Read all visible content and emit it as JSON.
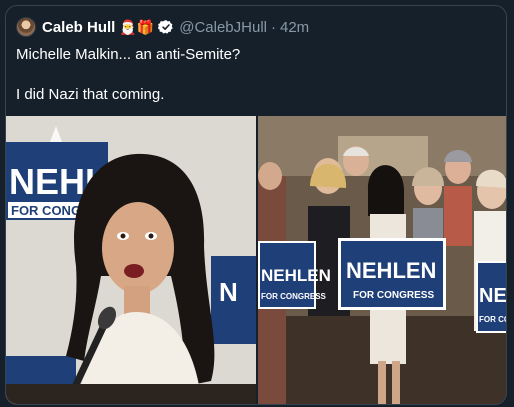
{
  "tweet": {
    "author_name": "Caleb Hull",
    "author_emojis": "🎅🎁",
    "handle": "@CalebJHull",
    "separator": "·",
    "time": "42m",
    "text_lines": [
      "Michelle Malkin... an anti-Semite?",
      "I did Nazi that coming."
    ]
  },
  "media": {
    "photo1": {
      "sign_line1": "NEHLEN",
      "sign_line2": "FOR CONGRESS"
    },
    "photo2": {
      "sign_a_line1": "NEHLEN",
      "sign_a_line2": "FOR CONGRESS",
      "sign_b_line1": "NEHLEN",
      "sign_b_line2": "FOR CONGRESS",
      "sign_c_line1": "NEHLEN",
      "sign_c_line2": "FOR CONGRESS"
    }
  },
  "colors": {
    "background": "#15202b",
    "border": "#38444d",
    "secondary_text": "#8899a6",
    "verified": "#ffffff",
    "sign_blue": "#1f3f78"
  },
  "icons": [
    "avatar",
    "verified-badge-icon"
  ]
}
